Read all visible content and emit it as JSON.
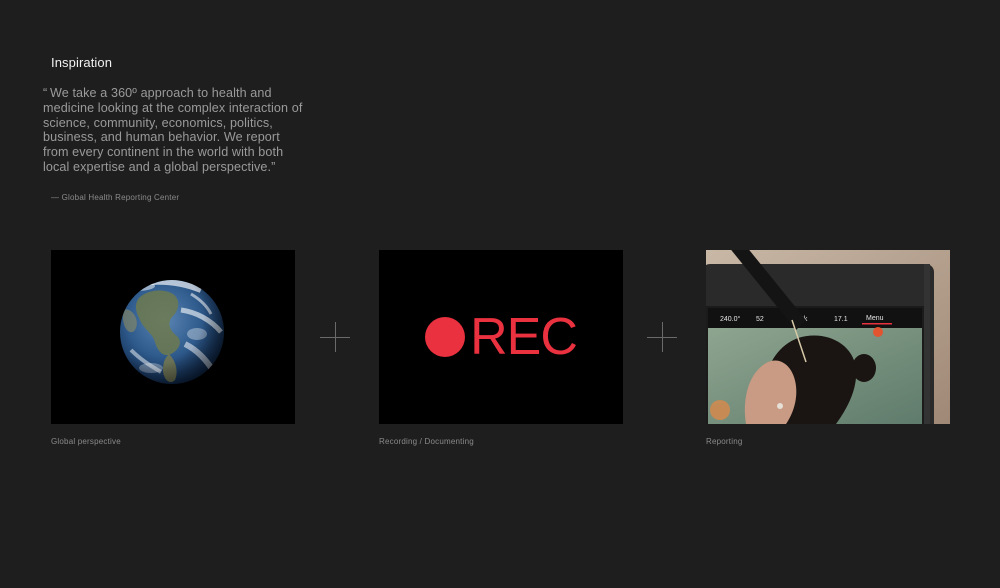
{
  "section": {
    "title": "Inspiration"
  },
  "quote": {
    "open_mark": "“",
    "text": "We take a 360º approach to health and medicine looking at the complex interaction of science, community, economics, politics, business, and human behavior. We report from every continent in the world with both local expertise and a global perspective.”",
    "attribution": "— Global Health Reporting Center"
  },
  "tiles": [
    {
      "caption": "Global perspective"
    },
    {
      "caption": "Recording / Documenting",
      "rec_label": "REC"
    },
    {
      "caption": "Reporting",
      "camera_readouts": [
        "240.0°",
        "52",
        "6k",
        "17.1",
        "Menu"
      ]
    }
  ],
  "colors": {
    "background": "#1e1e1e",
    "rec_red": "#e9313f",
    "title": "#f2f2f2",
    "muted_text": "#9a9a9a"
  }
}
